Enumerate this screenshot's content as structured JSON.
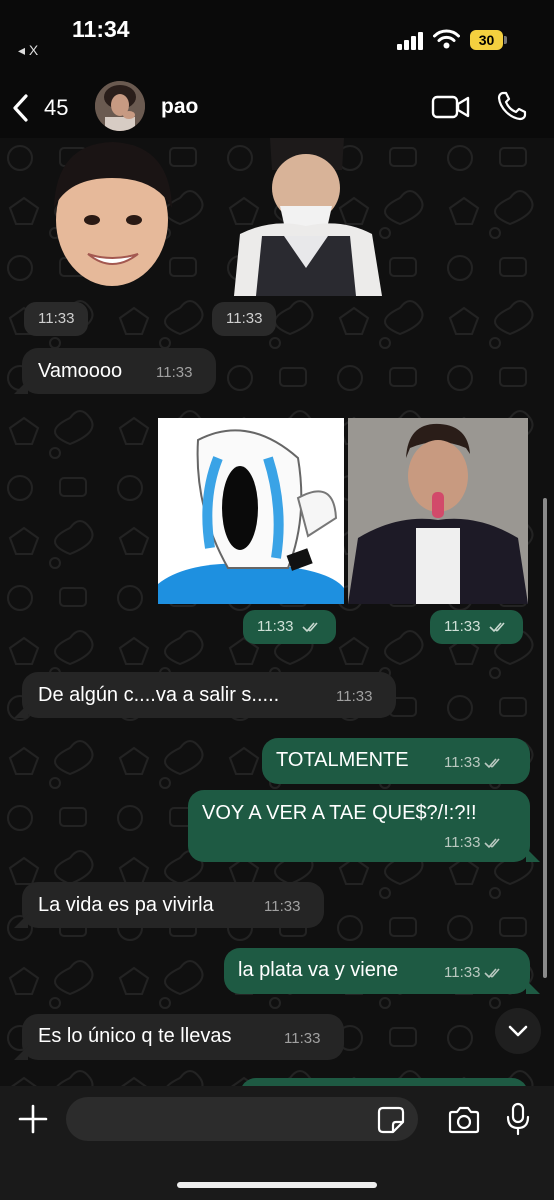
{
  "status_bar": {
    "time": "11:34",
    "back_app": "◂ X",
    "battery": "30",
    "battery_color": "#f4d03f"
  },
  "header": {
    "back_count": "45",
    "contact_name": "pao"
  },
  "messages": [
    {
      "id": "m1",
      "direction": "in",
      "type": "sticker",
      "time": "11:33"
    },
    {
      "id": "m2",
      "direction": "in",
      "type": "sticker",
      "time": "11:33"
    },
    {
      "id": "m3",
      "direction": "in",
      "type": "text",
      "text": "Vamoooo",
      "time": "11:33"
    },
    {
      "id": "m4",
      "direction": "out",
      "type": "image",
      "time": "11:33",
      "read": true
    },
    {
      "id": "m5",
      "direction": "out",
      "type": "image",
      "time": "11:33",
      "read": true
    },
    {
      "id": "m6",
      "direction": "in",
      "type": "text",
      "text": "De algún c....va a salir s.....",
      "time": "11:33"
    },
    {
      "id": "m7",
      "direction": "out",
      "type": "text",
      "text": "TOTALMENTE",
      "time": "11:33",
      "read": true
    },
    {
      "id": "m8",
      "direction": "out",
      "type": "text",
      "text": "VOY A VER A TAE QUE$?/!:?!!",
      "time": "11:33",
      "read": true
    },
    {
      "id": "m9",
      "direction": "in",
      "type": "text",
      "text": "La vida es pa vivirla",
      "time": "11:33"
    },
    {
      "id": "m10",
      "direction": "out",
      "type": "text",
      "text": "la plata va y viene",
      "time": "11:33",
      "read": true
    },
    {
      "id": "m11",
      "direction": "in",
      "type": "text",
      "text": "Es lo único q te llevas",
      "time": "11:33"
    }
  ],
  "composer": {
    "placeholder": ""
  },
  "colors": {
    "outgoing_bubble": "#1e5a43",
    "incoming_bubble": "#252525",
    "read_tick": "#b9c8c0"
  },
  "icons": [
    "back-chevron-icon",
    "video-call-icon",
    "phone-icon",
    "plus-icon",
    "sticker-icon",
    "camera-icon",
    "microphone-icon",
    "chevron-down-icon",
    "signal-icon",
    "wifi-icon"
  ]
}
